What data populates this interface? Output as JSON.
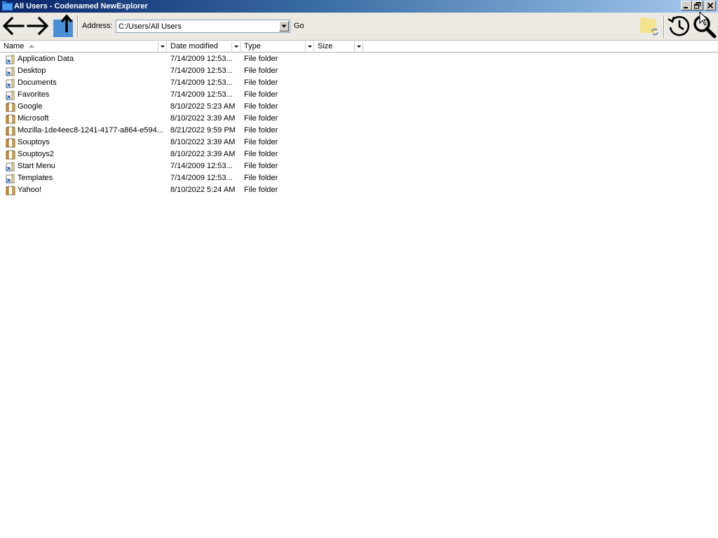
{
  "window": {
    "title": "All Users - Codenamed NewExplorer"
  },
  "toolbar": {
    "address_label": "Address:",
    "address_value": "C:/Users/All Users",
    "go_label": "Go"
  },
  "columns": {
    "name": "Name",
    "date": "Date modified",
    "type": "Type",
    "size": "Size"
  },
  "files": [
    {
      "name": "Application Data",
      "date": "7/14/2009 12:53...",
      "type": "File folder",
      "icon": "shortcut-folder-icon"
    },
    {
      "name": "Desktop",
      "date": "7/14/2009 12:53...",
      "type": "File folder",
      "icon": "shortcut-folder-icon"
    },
    {
      "name": "Documents",
      "date": "7/14/2009 12:53...",
      "type": "File folder",
      "icon": "shortcut-folder-icon"
    },
    {
      "name": "Favorites",
      "date": "7/14/2009 12:53...",
      "type": "File folder",
      "icon": "shortcut-folder-icon"
    },
    {
      "name": "Google",
      "date": "8/10/2022 5:23 AM",
      "type": "File folder",
      "icon": "folder-icon"
    },
    {
      "name": "Microsoft",
      "date": "8/10/2022 3:39 AM",
      "type": "File folder",
      "icon": "folder-icon"
    },
    {
      "name": "Mozilla-1de4eec8-1241-4177-a864-e594...",
      "date": "8/21/2022 9:59 PM",
      "type": "File folder",
      "icon": "folder-icon"
    },
    {
      "name": "Souptoys",
      "date": "8/10/2022 3:39 AM",
      "type": "File folder",
      "icon": "folder-icon"
    },
    {
      "name": "Souptoys2",
      "date": "8/10/2022 3:39 AM",
      "type": "File folder",
      "icon": "folder-icon"
    },
    {
      "name": "Start Menu",
      "date": "7/14/2009 12:53...",
      "type": "File folder",
      "icon": "shortcut-folder-icon"
    },
    {
      "name": "Templates",
      "date": "7/14/2009 12:53...",
      "type": "File folder",
      "icon": "shortcut-folder-icon"
    },
    {
      "name": "Yahoo!",
      "date": "8/10/2022 5:24 AM",
      "type": "File folder",
      "icon": "folder-icon"
    }
  ],
  "colors": {
    "title_gradient_start": "#0a246a",
    "title_gradient_end": "#a6caf0",
    "up_button_blue": "#4a90d9"
  }
}
